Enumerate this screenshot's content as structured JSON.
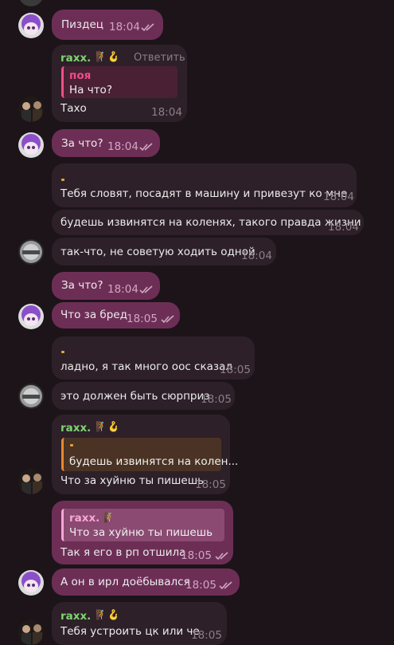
{
  "colors": {
    "outgoing": "#6d2e56",
    "incoming": "#2d2029",
    "sender_name": "#7ed56f",
    "quote_pink": "#ee4f86",
    "quote_orange": "#e8882b"
  },
  "messages": [
    {
      "text": "Пиздец",
      "time": "18:04"
    },
    {
      "sender": "raxx.",
      "reply_action": "Ответить",
      "quote_author": "поя",
      "quote_text": "На что?",
      "text": "Тахо",
      "time": "18:04"
    },
    {
      "text": "За что?",
      "time": "18:04"
    },
    {
      "sender": ".",
      "text": "Тебя словят, посадят в машину и привезут ко мне",
      "time": "18:04"
    },
    {
      "text": "будешь извинятся на коленях, такого правда жизни",
      "time": "18:04"
    },
    {
      "text": "так-что, не советую ходить одной",
      "time": "18:04"
    },
    {
      "text": "За что?",
      "time": "18:04"
    },
    {
      "text": "Что за бред",
      "time": "18:05"
    },
    {
      "sender": ".",
      "text": "ладно, я так много оос сказал",
      "time": "18:05"
    },
    {
      "text": "это должен быть сюрприз",
      "time": "18:05"
    },
    {
      "sender": "raxx.",
      "quote_author": ".",
      "quote_text": "будешь извинятся на колен...",
      "text": "Что за хуйню ты пишешь",
      "time": "18:05"
    },
    {
      "quote_author": "raxx.",
      "quote_text": "Что за хуйню ты пишешь",
      "text": "Так я его в рп отшила",
      "time": "18:05"
    },
    {
      "text": "А он в ирл доёбывался",
      "time": "18:05"
    },
    {
      "sender": "raxx.",
      "text": "Тебя устроить цк или че",
      "time": "18:05"
    }
  ]
}
